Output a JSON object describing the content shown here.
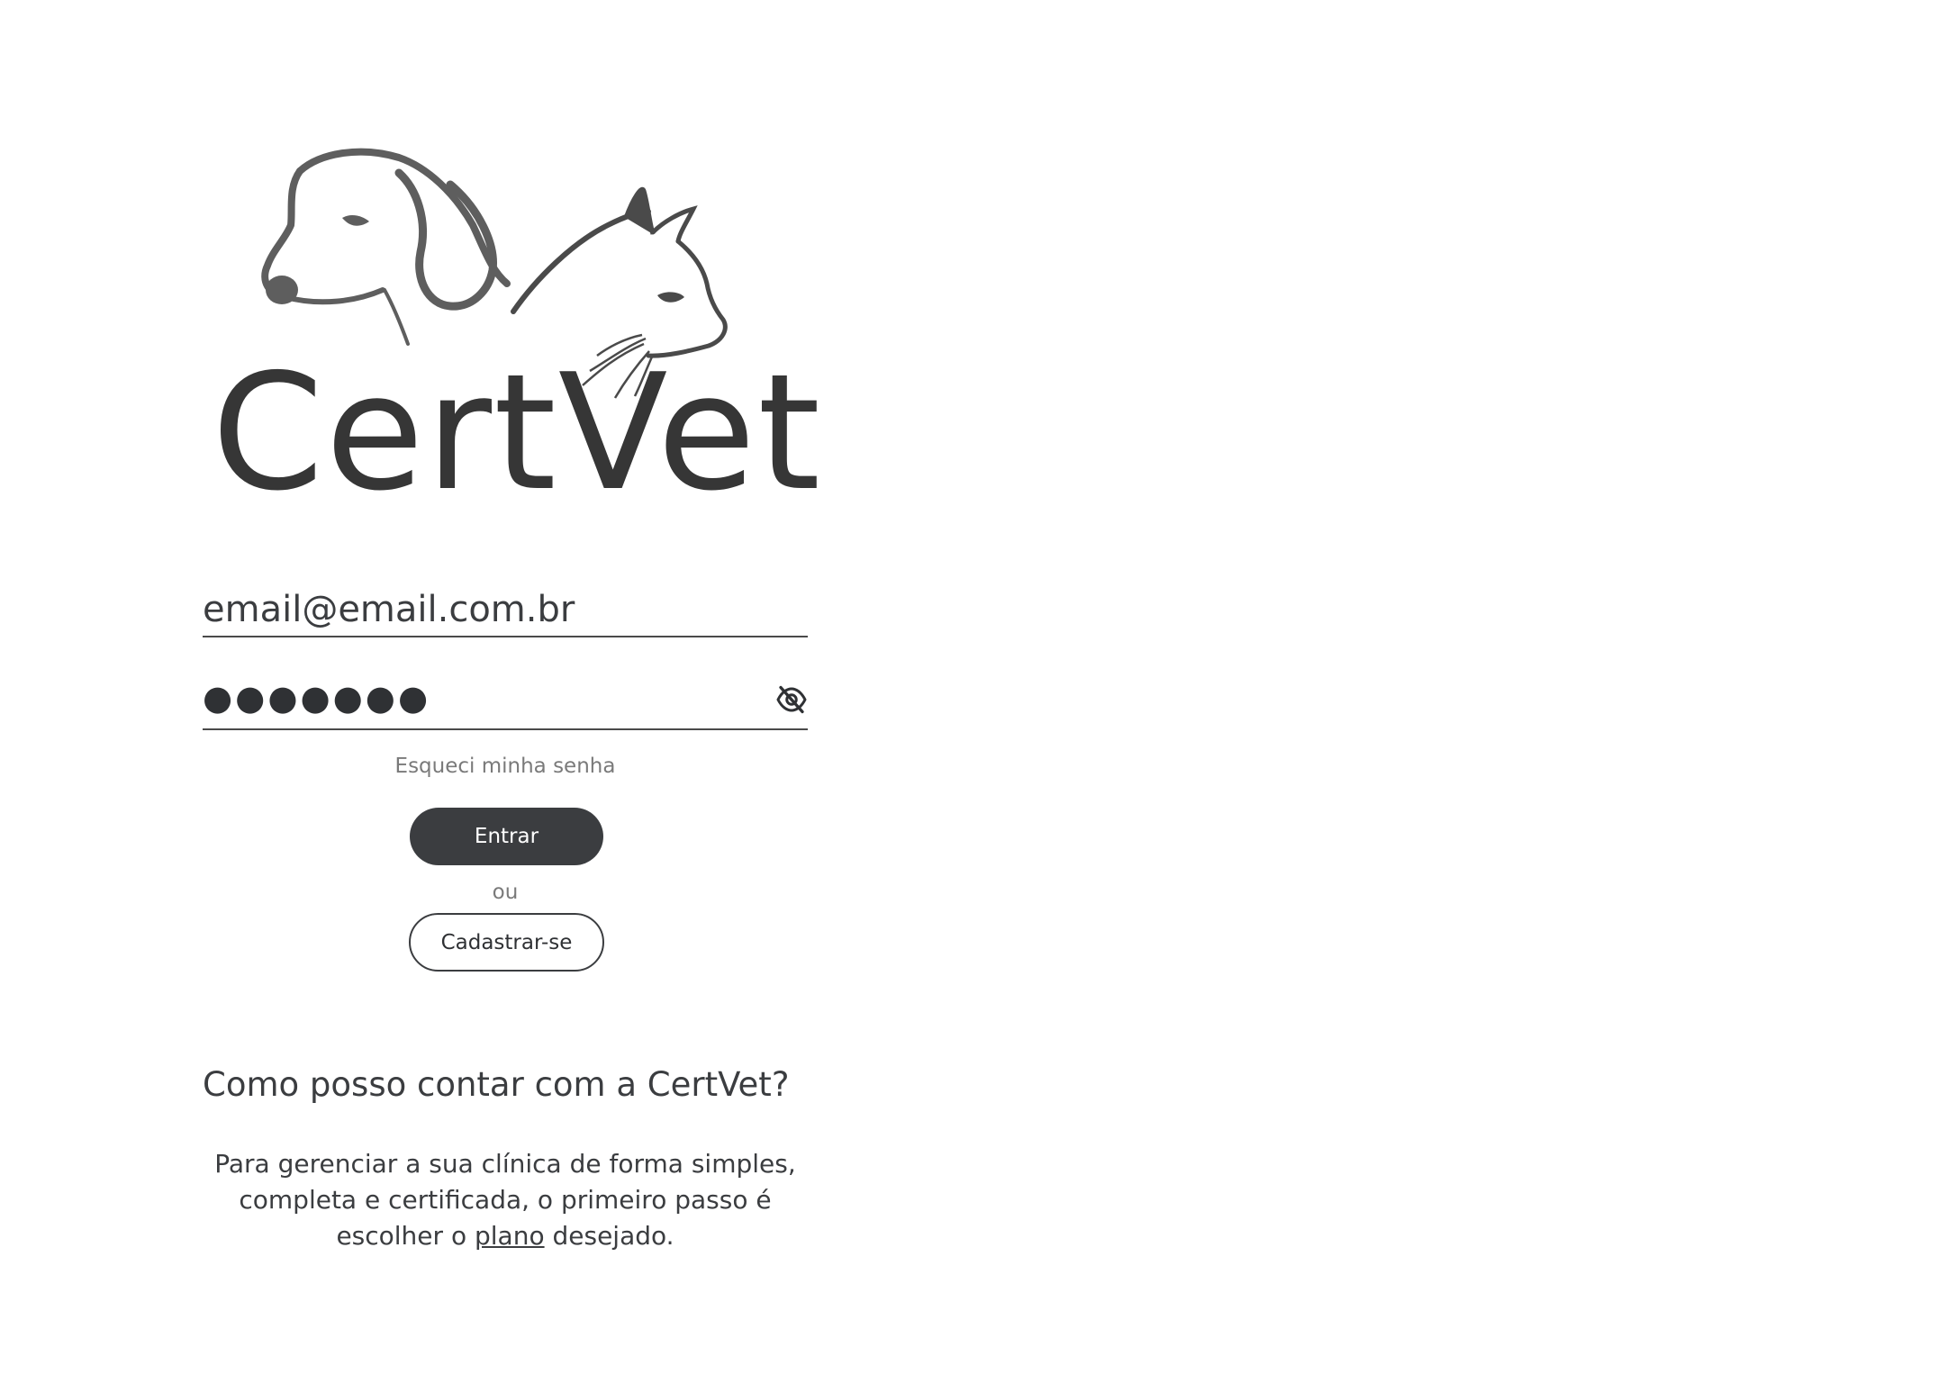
{
  "brand": {
    "name": "CertVet",
    "logo_icon": "dog-and-cat-logo-icon"
  },
  "login": {
    "email_value": "email@email.com.br",
    "password_mask": "●●●●●●●",
    "password_visibility_icon": "eye-slash-icon",
    "forgot_password_label": "Esqueci minha senha",
    "enter_label": "Entrar",
    "or_label": "ou",
    "signup_label": "Cadastrar-se"
  },
  "info": {
    "title": "Como posso contar com a CertVet?",
    "body_before_link": "Para gerenciar a sua clínica de forma simples, completa e certificada, o primeiro passo é escolher o ",
    "link_label": "plano",
    "body_after_link": " desejado."
  },
  "colors": {
    "primary": "#3b3d40",
    "muted_text": "#7a7a7a",
    "background": "#ffffff"
  }
}
